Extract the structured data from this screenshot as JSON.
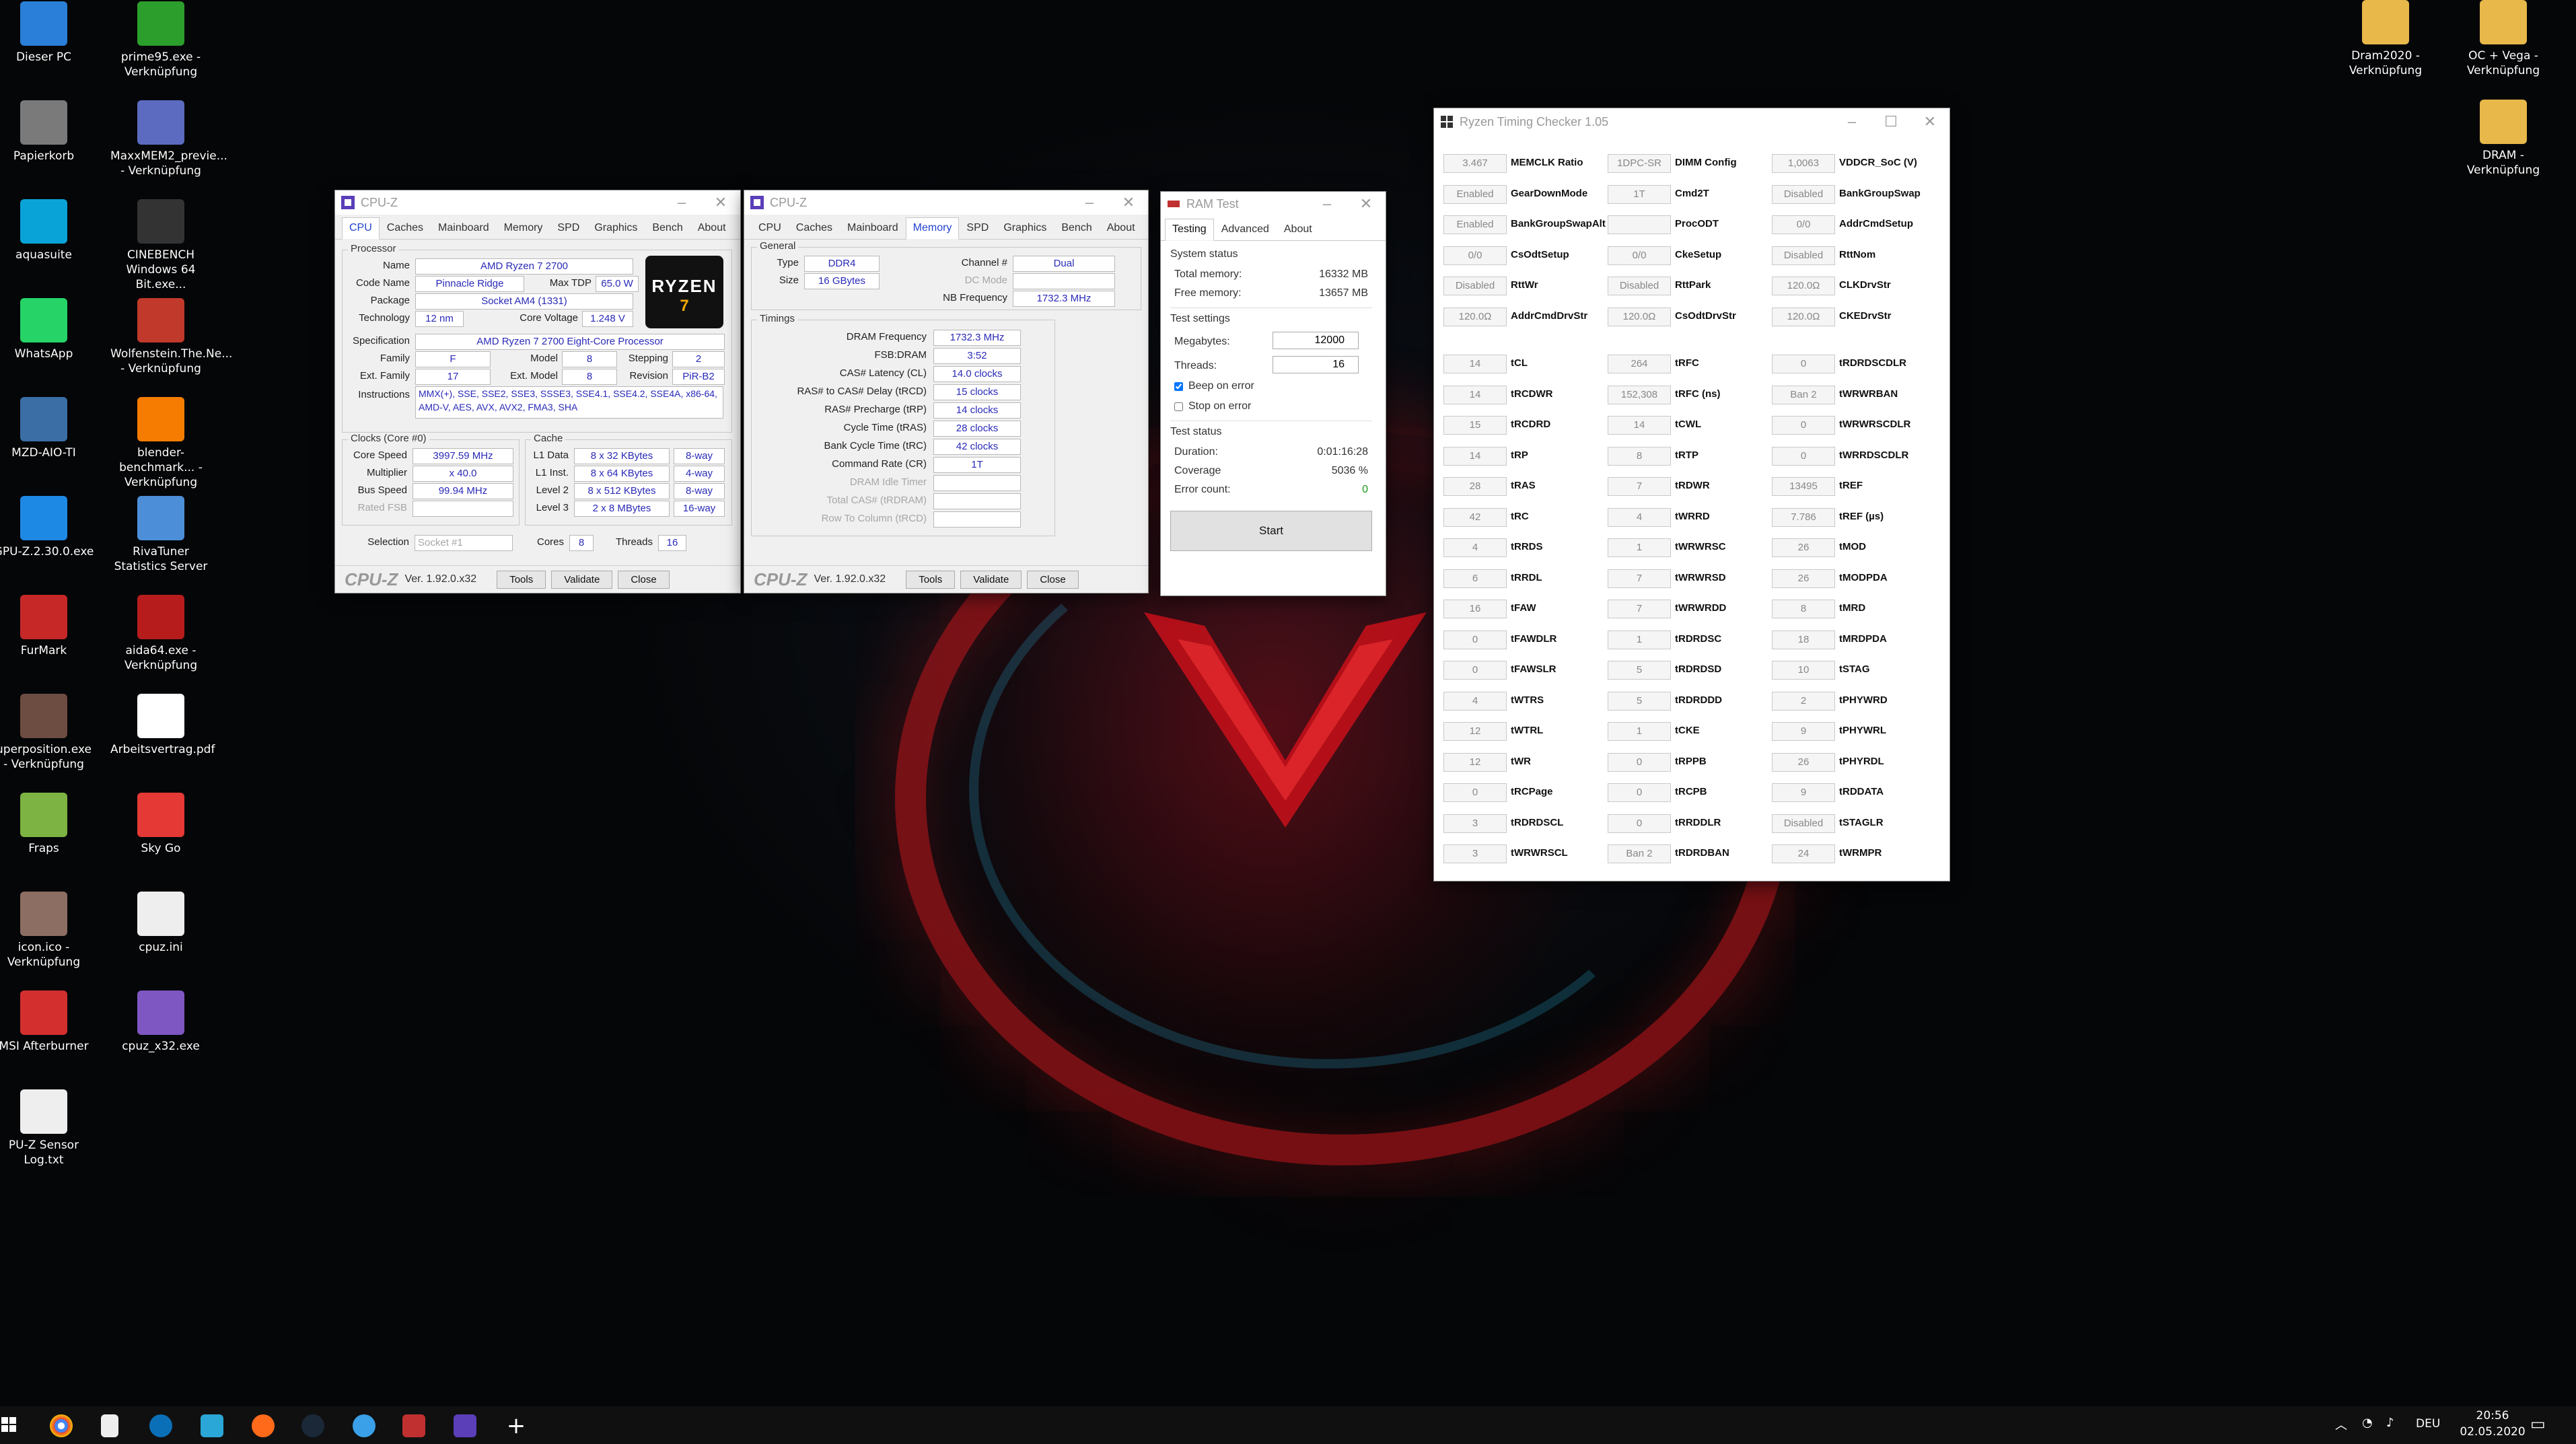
{
  "desktop": {
    "icons_left": [
      {
        "label": "Dieser PC"
      },
      {
        "label": "prime95.exe - Verknüpfung"
      },
      {
        "label": "Papierkorb"
      },
      {
        "label": "MaxxMEM2_previe... - Verknüpfung"
      },
      {
        "label": "aquasuite"
      },
      {
        "label": "CINEBENCH Windows 64 Bit.exe..."
      },
      {
        "label": "WhatsApp"
      },
      {
        "label": "Wolfenstein.The.Ne... - Verknüpfung"
      },
      {
        "label": "MZD-AIO-TI"
      },
      {
        "label": "blender-benchmark... - Verknüpfung"
      },
      {
        "label": "GPU-Z.2.30.0.exe"
      },
      {
        "label": "RivaTuner Statistics Server"
      },
      {
        "label": "FurMark"
      },
      {
        "label": "aida64.exe - Verknüpfung"
      },
      {
        "label": "uperposition.exe - Verknüpfung"
      },
      {
        "label": "Arbeitsvertrag.pdf"
      },
      {
        "label": "Fraps"
      },
      {
        "label": "Sky Go"
      },
      {
        "label": "icon.ico - Verknüpfung"
      },
      {
        "label": "cpuz.ini"
      },
      {
        "label": "MSI Afterburner"
      },
      {
        "label": "cpuz_x32.exe"
      },
      {
        "label": "PU-Z Sensor Log.txt"
      }
    ],
    "icons_right": [
      {
        "label": "Dram2020 - Verknüpfung"
      },
      {
        "label": "OC + Vega - Verknüpfung"
      },
      {
        "label": "DRAM - Verknüpfung"
      }
    ]
  },
  "cpuz_cpu": {
    "title": "CPU-Z",
    "tabs": [
      "CPU",
      "Caches",
      "Mainboard",
      "Memory",
      "SPD",
      "Graphics",
      "Bench",
      "About"
    ],
    "active_tab": "CPU",
    "processor_group": "Processor",
    "name_label": "Name",
    "name": "AMD Ryzen 7 2700",
    "codename_label": "Code Name",
    "codename": "Pinnacle Ridge",
    "maxtdp_label": "Max TDP",
    "maxtdp": "65.0 W",
    "package_label": "Package",
    "package": "Socket AM4 (1331)",
    "technology_label": "Technology",
    "technology": "12 nm",
    "corevoltage_label": "Core Voltage",
    "corevoltage": "1.248 V",
    "spec_label": "Specification",
    "spec": "AMD Ryzen 7 2700 Eight-Core Processor",
    "family_label": "Family",
    "family": "F",
    "model_label": "Model",
    "model": "8",
    "stepping_label": "Stepping",
    "stepping": "2",
    "extfamily_label": "Ext. Family",
    "extfamily": "17",
    "extmodel_label": "Ext. Model",
    "extmodel": "8",
    "revision_label": "Revision",
    "revision": "PiR-B2",
    "instructions_label": "Instructions",
    "instructions": "MMX(+), SSE, SSE2, SSE3, SSSE3, SSE4.1, SSE4.2, SSE4A, x86-64, AMD-V, AES, AVX, AVX2, FMA3, SHA",
    "clocks_group": "Clocks (Core #0)",
    "corespeed_label": "Core Speed",
    "corespeed": "3997.59 MHz",
    "multiplier_label": "Multiplier",
    "multiplier": "x 40.0",
    "busspeed_label": "Bus Speed",
    "busspeed": "99.94 MHz",
    "ratedfsb_label": "Rated FSB",
    "cache_group": "Cache",
    "l1data_label": "L1 Data",
    "l1data": "8 x 32 KBytes",
    "l1data_way": "8-way",
    "l1inst_label": "L1 Inst.",
    "l1inst": "8 x 64 KBytes",
    "l1inst_way": "4-way",
    "level2_label": "Level 2",
    "level2": "8 x 512 KBytes",
    "level2_way": "8-way",
    "level3_label": "Level 3",
    "level3": "2 x 8 MBytes",
    "level3_way": "16-way",
    "selection_label": "Selection",
    "selection": "Socket #1",
    "cores_label": "Cores",
    "cores": "8",
    "threads_label": "Threads",
    "threads": "16",
    "logo_badge": "RYZEN",
    "logo_num": "7",
    "footer_logo": "CPU-Z",
    "version": "Ver. 1.92.0.x32",
    "tools": "Tools",
    "validate": "Validate",
    "close": "Close"
  },
  "cpuz_mem": {
    "title": "CPU-Z",
    "tabs": [
      "CPU",
      "Caches",
      "Mainboard",
      "Memory",
      "SPD",
      "Graphics",
      "Bench",
      "About"
    ],
    "active_tab": "Memory",
    "general_group": "General",
    "type_label": "Type",
    "type": "DDR4",
    "channel_label": "Channel #",
    "channel": "Dual",
    "size_label": "Size",
    "size": "16 GBytes",
    "dcmode_label": "DC Mode",
    "nbfreq_label": "NB Frequency",
    "nbfreq": "1732.3 MHz",
    "timings_group": "Timings",
    "timings": [
      {
        "label": "DRAM Frequency",
        "value": "1732.3 MHz",
        "faded": false
      },
      {
        "label": "FSB:DRAM",
        "value": "3:52",
        "faded": false
      },
      {
        "label": "CAS# Latency (CL)",
        "value": "14.0 clocks",
        "faded": false
      },
      {
        "label": "RAS# to CAS# Delay (tRCD)",
        "value": "15 clocks",
        "faded": false
      },
      {
        "label": "RAS# Precharge (tRP)",
        "value": "14 clocks",
        "faded": false
      },
      {
        "label": "Cycle Time (tRAS)",
        "value": "28 clocks",
        "faded": false
      },
      {
        "label": "Bank Cycle Time (tRC)",
        "value": "42 clocks",
        "faded": false
      },
      {
        "label": "Command Rate (CR)",
        "value": "1T",
        "faded": false
      },
      {
        "label": "DRAM Idle Timer",
        "value": "",
        "faded": true
      },
      {
        "label": "Total CAS# (tRDRAM)",
        "value": "",
        "faded": true
      },
      {
        "label": "Row To Column (tRCD)",
        "value": "",
        "faded": true
      }
    ],
    "footer_logo": "CPU-Z",
    "version": "Ver. 1.92.0.x32",
    "tools": "Tools",
    "validate": "Validate",
    "close": "Close"
  },
  "ramtest": {
    "title": "RAM Test",
    "tabs": [
      "Testing",
      "Advanced",
      "About"
    ],
    "active_tab": "Testing",
    "system_status": "System status",
    "total_memory_label": "Total memory:",
    "total_memory": "16332 MB",
    "free_memory_label": "Free memory:",
    "free_memory": "13657 MB",
    "test_settings": "Test settings",
    "megabytes_label": "Megabytes:",
    "megabytes": "12000",
    "threads_label": "Threads:",
    "threads": "16",
    "beep_label": "Beep on error",
    "beep_checked": true,
    "stop_label": "Stop on error",
    "stop_checked": false,
    "test_status": "Test status",
    "duration_label": "Duration:",
    "duration": "0:01:16:28",
    "coverage_label": "Coverage",
    "coverage": "5036 %",
    "errors_label": "Error count:",
    "errors": "0",
    "start": "Start"
  },
  "rtc": {
    "title": "Ryzen Timing Checker 1.05",
    "top_rows": [
      [
        {
          "v": "3.467",
          "n": "MEMCLK Ratio"
        },
        {
          "v": "1DPC-SR",
          "n": "DIMM Config"
        },
        {
          "v": "1,0063",
          "n": "VDDCR_SoC (V)"
        }
      ],
      [
        {
          "v": "Enabled",
          "n": "GearDownMode"
        },
        {
          "v": "1T",
          "n": "Cmd2T"
        },
        {
          "v": "Disabled",
          "n": "BankGroupSwap"
        }
      ],
      [
        {
          "v": "Enabled",
          "n": "BankGroupSwapAlt"
        },
        {
          "v": "",
          "n": "ProcODT"
        },
        {
          "v": "0/0",
          "n": "AddrCmdSetup"
        }
      ],
      [
        {
          "v": "0/0",
          "n": "CsOdtSetup"
        },
        {
          "v": "0/0",
          "n": "CkeSetup"
        },
        {
          "v": "Disabled",
          "n": "RttNom"
        }
      ],
      [
        {
          "v": "Disabled",
          "n": "RttWr"
        },
        {
          "v": "Disabled",
          "n": "RttPark"
        },
        {
          "v": "120.0Ω",
          "n": "CLKDrvStr"
        }
      ],
      [
        {
          "v": "120.0Ω",
          "n": "AddrCmdDrvStr"
        },
        {
          "v": "120.0Ω",
          "n": "CsOdtDrvStr"
        },
        {
          "v": "120.0Ω",
          "n": "CKEDrvStr"
        }
      ]
    ],
    "timing_rows": [
      [
        {
          "v": "14",
          "n": "tCL"
        },
        {
          "v": "264",
          "n": "tRFC"
        },
        {
          "v": "0",
          "n": "tRDRDSCDLR"
        }
      ],
      [
        {
          "v": "14",
          "n": "tRCDWR"
        },
        {
          "v": "152,308",
          "n": "tRFC (ns)"
        },
        {
          "v": "Ban 2",
          "n": "tWRWRBAN"
        }
      ],
      [
        {
          "v": "15",
          "n": "tRCDRD"
        },
        {
          "v": "14",
          "n": "tCWL"
        },
        {
          "v": "0",
          "n": "tWRWRSCDLR"
        }
      ],
      [
        {
          "v": "14",
          "n": "tRP"
        },
        {
          "v": "8",
          "n": "tRTP"
        },
        {
          "v": "0",
          "n": "tWRRDSCDLR"
        }
      ],
      [
        {
          "v": "28",
          "n": "tRAS"
        },
        {
          "v": "7",
          "n": "tRDWR"
        },
        {
          "v": "13495",
          "n": "tREF"
        }
      ],
      [
        {
          "v": "42",
          "n": "tRC"
        },
        {
          "v": "4",
          "n": "tWRRD"
        },
        {
          "v": "7.786",
          "n": "tREF (µs)"
        }
      ],
      [
        {
          "v": "4",
          "n": "tRRDS"
        },
        {
          "v": "1",
          "n": "tWRWRSC"
        },
        {
          "v": "26",
          "n": "tMOD"
        }
      ],
      [
        {
          "v": "6",
          "n": "tRRDL"
        },
        {
          "v": "7",
          "n": "tWRWRSD"
        },
        {
          "v": "26",
          "n": "tMODPDA"
        }
      ],
      [
        {
          "v": "16",
          "n": "tFAW"
        },
        {
          "v": "7",
          "n": "tWRWRDD"
        },
        {
          "v": "8",
          "n": "tMRD"
        }
      ],
      [
        {
          "v": "0",
          "n": "tFAWDLR"
        },
        {
          "v": "1",
          "n": "tRDRDSC"
        },
        {
          "v": "18",
          "n": "tMRDPDA"
        }
      ],
      [
        {
          "v": "0",
          "n": "tFAWSLR"
        },
        {
          "v": "5",
          "n": "tRDRDSD"
        },
        {
          "v": "10",
          "n": "tSTAG"
        }
      ],
      [
        {
          "v": "4",
          "n": "tWTRS"
        },
        {
          "v": "5",
          "n": "tRDRDDD"
        },
        {
          "v": "2",
          "n": "tPHYWRD"
        }
      ],
      [
        {
          "v": "12",
          "n": "tWTRL"
        },
        {
          "v": "1",
          "n": "tCKE"
        },
        {
          "v": "9",
          "n": "tPHYWRL"
        }
      ],
      [
        {
          "v": "12",
          "n": "tWR"
        },
        {
          "v": "0",
          "n": "tRPPB"
        },
        {
          "v": "26",
          "n": "tPHYRDL"
        }
      ],
      [
        {
          "v": "0",
          "n": "tRCPage"
        },
        {
          "v": "0",
          "n": "tRCPB"
        },
        {
          "v": "9",
          "n": "tRDDATA"
        }
      ],
      [
        {
          "v": "3",
          "n": "tRDRDSCL"
        },
        {
          "v": "0",
          "n": "tRRDDLR"
        },
        {
          "v": "Disabled",
          "n": "tSTAGLR"
        }
      ],
      [
        {
          "v": "3",
          "n": "tWRWRSCL"
        },
        {
          "v": "Ban 2",
          "n": "tRDRDBAN"
        },
        {
          "v": "24",
          "n": "tWRMPR"
        }
      ]
    ]
  },
  "taskbar": {
    "language": "DEU",
    "time": "20:56",
    "date": "02.05.2020"
  }
}
